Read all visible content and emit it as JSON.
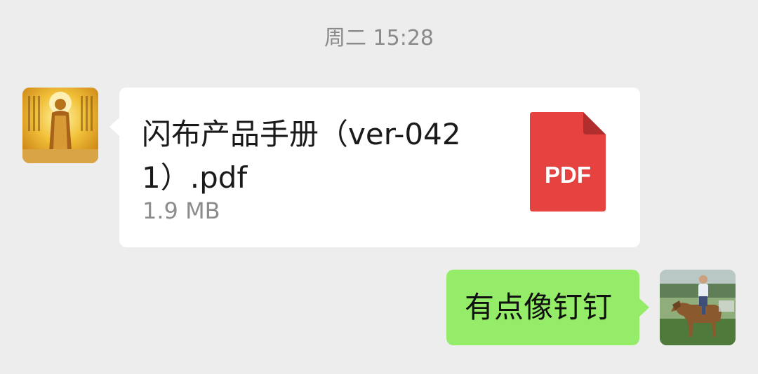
{
  "chat": {
    "timestamp": "周二 15:28",
    "messages": [
      {
        "sender": "other",
        "type": "file",
        "file_name": "闪布产品手册（ver-0421）.pdf",
        "file_size": "1.9 MB",
        "file_icon_label": "PDF",
        "file_icon_color": "#e64340"
      },
      {
        "sender": "self",
        "type": "text",
        "text": "有点像钉钉",
        "bubble_color": "#95ec69"
      }
    ]
  }
}
